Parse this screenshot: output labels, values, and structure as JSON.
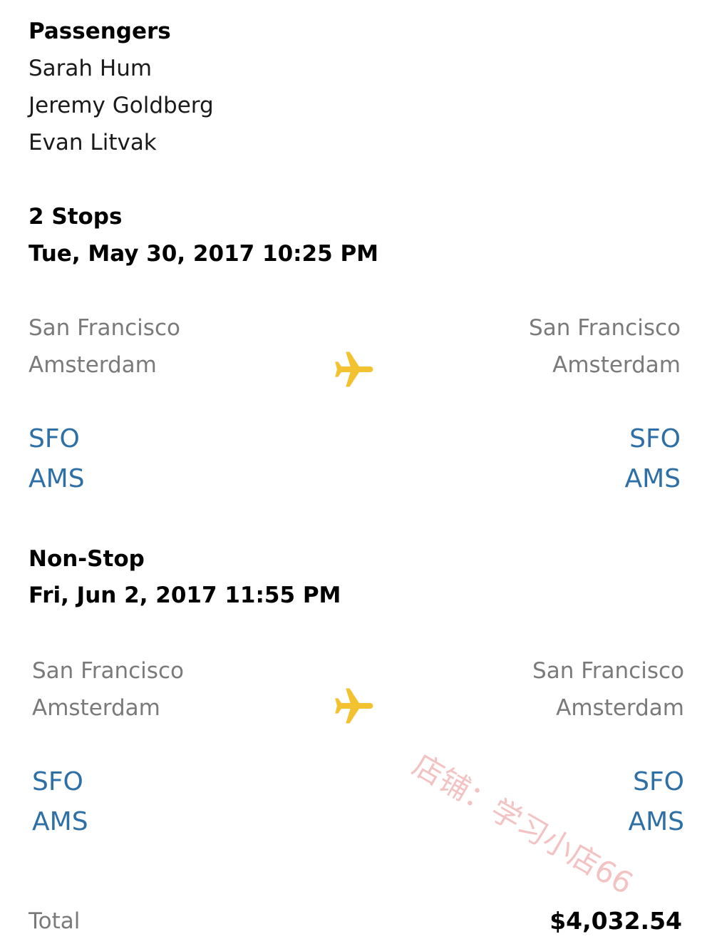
{
  "passengers": {
    "title": "Passengers",
    "names": [
      "Sarah Hum",
      "Jeremy Goldberg",
      "Evan Litvak"
    ]
  },
  "flights": [
    {
      "stops": "2 Stops",
      "datetime": "Tue, May 30, 2017 10:25 PM",
      "origin": {
        "city1": "San Francisco",
        "city2": "Amsterdam",
        "code1": "SFO",
        "code2": "AMS"
      },
      "destination": {
        "city1": "San Francisco",
        "city2": "Amsterdam",
        "code1": "SFO",
        "code2": "AMS"
      },
      "icon": "airplane-icon"
    },
    {
      "stops": "Non-Stop",
      "datetime": "Fri, Jun 2, 2017 11:55 PM",
      "origin": {
        "city1": "San Francisco",
        "city2": "Amsterdam",
        "code1": "SFO",
        "code2": "AMS"
      },
      "destination": {
        "city1": "San Francisco",
        "city2": "Amsterdam",
        "code1": "SFO",
        "code2": "AMS"
      },
      "icon": "airplane-icon"
    }
  ],
  "total": {
    "label": "Total",
    "value": "$4,032.54"
  },
  "watermark": "店铺：学习小店66",
  "colors": {
    "code_blue": "#2e6fa6",
    "plane_yellow": "#f2c230",
    "muted_gray": "#7a7a7a"
  }
}
